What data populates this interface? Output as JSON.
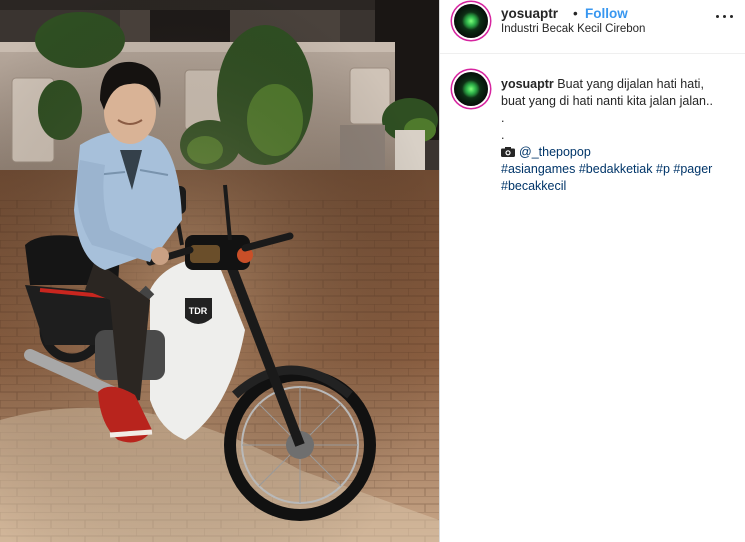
{
  "header": {
    "username": "yosuaptr",
    "separator": "•",
    "follow_label": "Follow",
    "location": "Industri Becak Kecil Cirebon",
    "more_icon": "more-options-icon"
  },
  "caption": {
    "username": "yosuaptr",
    "line1": "Buat yang dijalan hati hati,",
    "line2": "buat yang di hati nanti kita jalan jalan..",
    "dot1": ".",
    "dot2": ".",
    "camera_icon": "camera-icon",
    "mention": "@_thepopop",
    "hashtags_line1": [
      "#asiangames",
      "#bedakketiak",
      "#p",
      "#pager"
    ],
    "hashtags_line2": [
      "#becakkecil"
    ]
  },
  "photo": {
    "description_icon": "post-photo",
    "badge_text": "TDR"
  }
}
